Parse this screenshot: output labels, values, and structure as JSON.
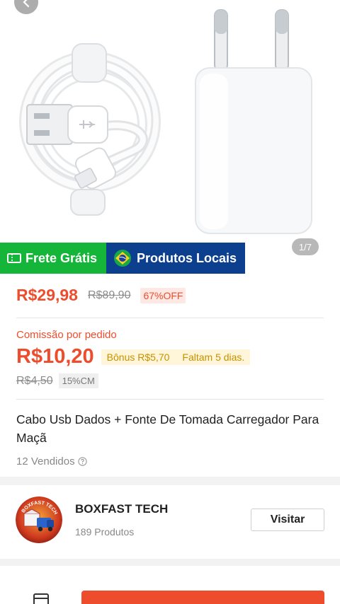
{
  "gallery": {
    "counter": "1/7"
  },
  "badges": {
    "free_shipping": "Frete Grátis",
    "local_products": "Produtos Locais"
  },
  "price": {
    "current": "R$29,98",
    "original": "R$89,90",
    "discount": "67%OFF"
  },
  "commission": {
    "label": "Comissão por pedido",
    "value": "R$10,20",
    "bonus": "Bônus R$5,70",
    "remaining": "Faltam 5 dias.",
    "old_value": "R$4,50",
    "rate": "15%CM"
  },
  "product": {
    "title": "Cabo Usb Dados + Fonte De Tomada Carregador Para Maçã",
    "sold": "12 Vendidos"
  },
  "shop": {
    "name": "BOXFAST TECH",
    "products": "189 Produtos",
    "visit_label": "Visitar",
    "logo_text": "BOXFAST TECH"
  },
  "colors": {
    "accent": "#ee4d2d",
    "free_shipping": "#14b539",
    "local_products": "#0d3f8f"
  }
}
